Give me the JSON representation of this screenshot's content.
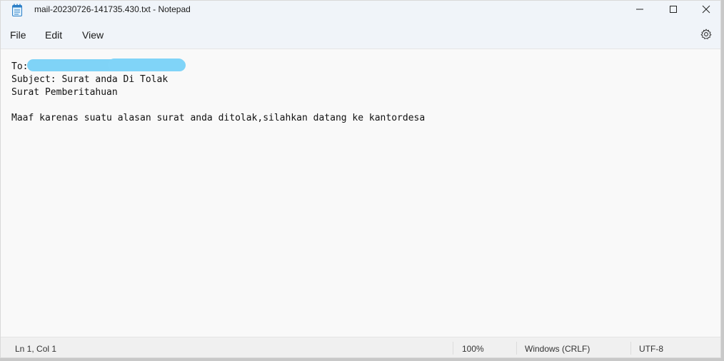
{
  "window": {
    "title": "mail-20230726-141735.430.txt - Notepad"
  },
  "menu": {
    "file": "File",
    "edit": "Edit",
    "view": "View"
  },
  "editor": {
    "to_label": "To:",
    "subject": "Subject: Surat anda Di Tolak",
    "line3": "Surat Pemberitahuan",
    "body": "Maaf karenas suatu alasan surat anda ditolak,silahkan datang ke kantordesa",
    "redaction_color": "#7fd3f7"
  },
  "status": {
    "position": "Ln 1, Col 1",
    "zoom": "100%",
    "line_ending": "Windows (CRLF)",
    "encoding": "UTF-8"
  },
  "icons": [
    "notepad-icon",
    "minimize-icon",
    "maximize-icon",
    "close-icon",
    "settings-icon"
  ]
}
